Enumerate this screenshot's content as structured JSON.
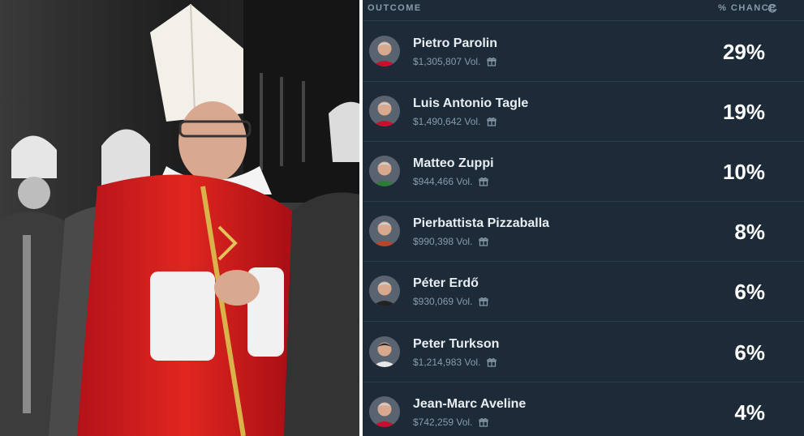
{
  "header": {
    "outcome_label": "OUTCOME",
    "chance_label": "% CHANCE",
    "refresh_icon": "refresh-icon"
  },
  "vol_suffix": "Vol.",
  "candidates": [
    {
      "name": "Pietro Parolin",
      "volume": "$1,305,807",
      "chance": "29%",
      "avatar_color": "#c8102e"
    },
    {
      "name": "Luis Antonio Tagle",
      "volume": "$1,490,642",
      "chance": "19%",
      "avatar_color": "#c8102e"
    },
    {
      "name": "Matteo Zuppi",
      "volume": "$944,466",
      "chance": "10%",
      "avatar_color": "#2d7a3a"
    },
    {
      "name": "Pierbattista Pizzaballa",
      "volume": "$990,398",
      "chance": "8%",
      "avatar_color": "#b5452b"
    },
    {
      "name": "Péter Erdő",
      "volume": "$930,069",
      "chance": "6%",
      "avatar_color": "#222222"
    },
    {
      "name": "Peter Turkson",
      "volume": "$1,214,983",
      "chance": "6%",
      "avatar_color": "#e8e8e8"
    },
    {
      "name": "Jean-Marc Aveline",
      "volume": "$742,259",
      "chance": "4%",
      "avatar_color": "#c8102e"
    }
  ],
  "colors": {
    "panel_bg": "#1d2b39",
    "divider": "#2c3b4a",
    "text_primary": "#e8edf2",
    "text_muted": "#8a9aab"
  }
}
